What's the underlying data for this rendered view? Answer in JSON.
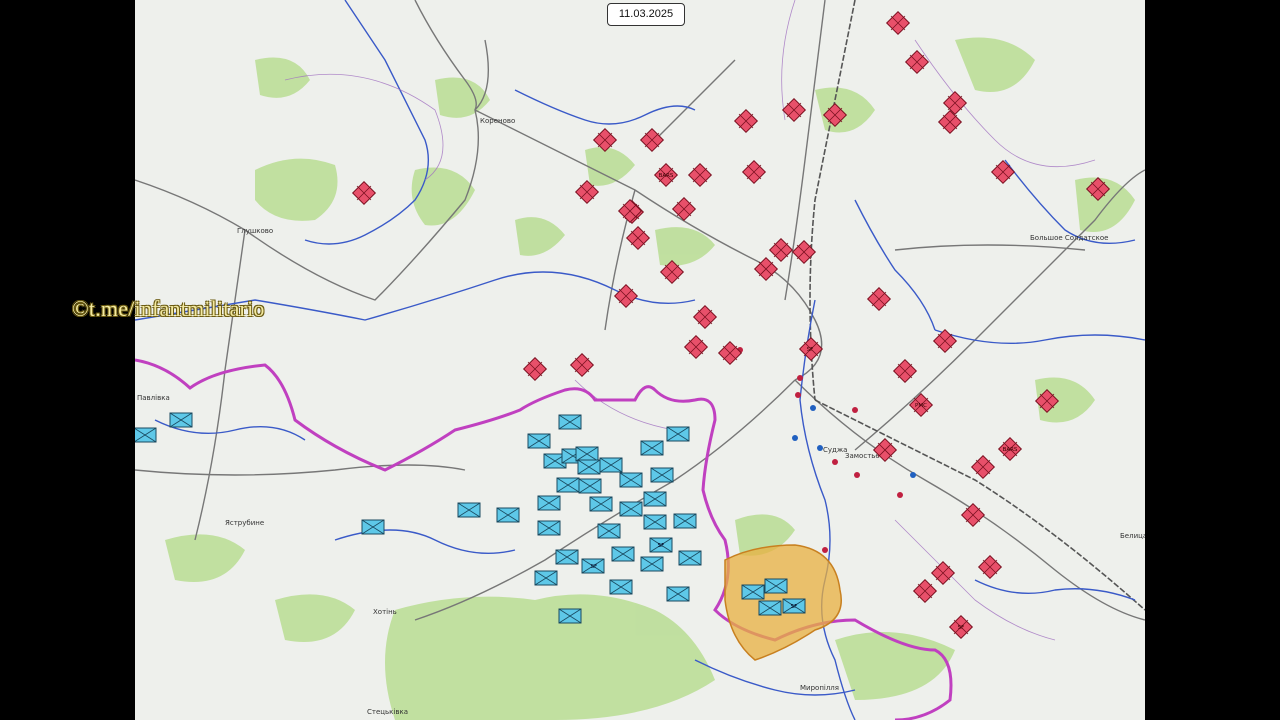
{
  "date": "11.03.2025",
  "watermark": "©t.me/infantmilitario",
  "places": [
    {
      "name": "Кореново"
    },
    {
      "name": "Глушково"
    },
    {
      "name": "Павлівка"
    },
    {
      "name": "Яструбине"
    },
    {
      "name": "Хотінь"
    },
    {
      "name": "Стецьківка"
    },
    {
      "name": "Суджа"
    },
    {
      "name": "Замостье"
    },
    {
      "name": "Большое Солдатское"
    },
    {
      "name": "Белица"
    },
    {
      "name": "Миропілля"
    }
  ],
  "unit_labels": {
    "bars": "BARS",
    "sf": "SF",
    "pmc": "PMC"
  },
  "colors": {
    "russian_units": "#e8506a",
    "ukrainian_units": "#5ec8e8",
    "border": "#c040c0",
    "encirclement": "#e8b040",
    "rivers": "#3050c0",
    "forest": "#b4dc8c"
  }
}
